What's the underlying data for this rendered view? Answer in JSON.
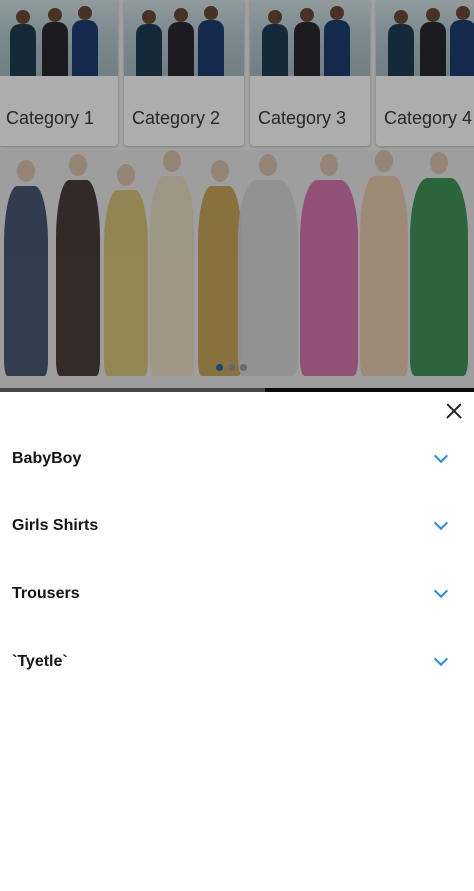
{
  "categories": [
    {
      "label": "Category 1"
    },
    {
      "label": "Category 2"
    },
    {
      "label": "Category 3"
    },
    {
      "label": "Category 4"
    }
  ],
  "banner": {
    "image": "fashion-sketches-illustration",
    "pager": {
      "pages": 3,
      "active_index": 0
    }
  },
  "sheet": {
    "close_icon": "close-icon",
    "items": [
      {
        "label": "BabyBoy",
        "icon": "chevron-down-icon"
      },
      {
        "label": "Girls Shirts",
        "icon": "chevron-down-icon"
      },
      {
        "label": "Trousers",
        "icon": "chevron-down-icon"
      },
      {
        "label": "`Tyetle`",
        "icon": "chevron-down-icon"
      }
    ]
  },
  "colors": {
    "accent": "#2a8fd6",
    "pager_active": "#1e6fb3",
    "overlay": "rgba(0,0,0,0.32)"
  }
}
